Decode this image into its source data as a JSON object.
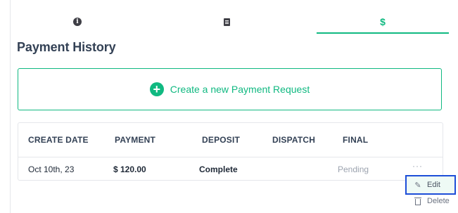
{
  "tabs": [
    {
      "name": "info",
      "icon": "info-icon"
    },
    {
      "name": "receipt",
      "icon": "receipt-icon"
    },
    {
      "name": "payment",
      "icon": "dollar-icon",
      "glyph": "$",
      "active": true
    }
  ],
  "heading": "Payment History",
  "create_button": {
    "label": "Create a new Payment Request",
    "icon": "plus-circle-icon",
    "plus_glyph": "+"
  },
  "table": {
    "columns": [
      "CREATE DATE",
      "PAYMENT",
      "DEPOSIT",
      "DISPATCH",
      "FINAL"
    ],
    "rows": [
      {
        "create_date": "Oct 10th, 23",
        "payment": "$ 120.00",
        "deposit": "Complete",
        "dispatch": "",
        "final": "Pending",
        "actions": "···"
      }
    ]
  },
  "row_menu": {
    "items": [
      {
        "label": "Edit",
        "icon": "pencil-icon",
        "glyph": "✎",
        "highlighted": true
      },
      {
        "label": "Delete",
        "icon": "trash-icon"
      }
    ]
  },
  "colors": {
    "accent": "#10b981",
    "heading": "#334155",
    "focus_outline": "#1d4ed8"
  }
}
